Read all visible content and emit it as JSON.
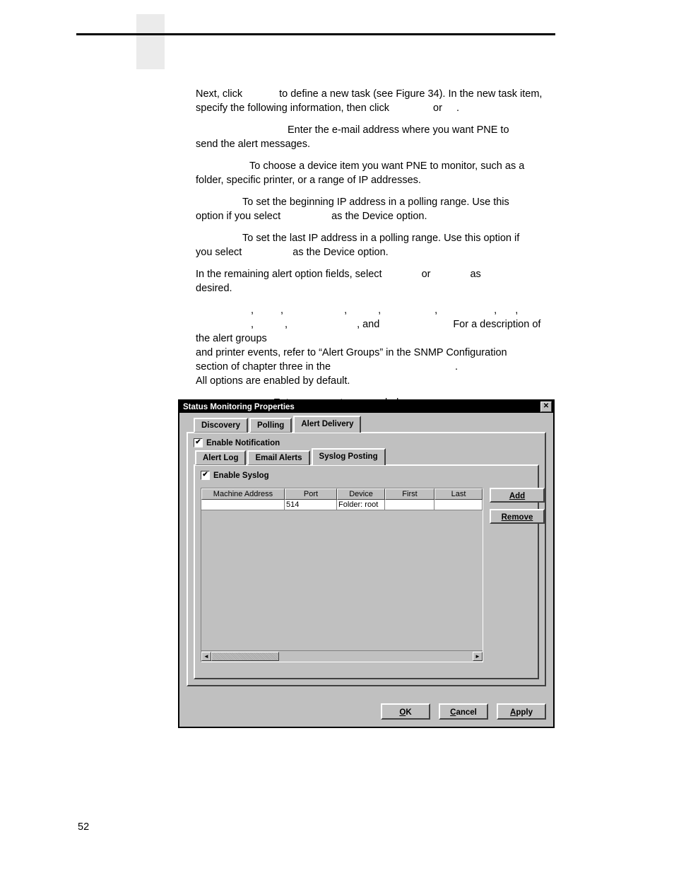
{
  "page": {
    "number": "52"
  },
  "body": {
    "p1_a": "Next, click",
    "p1_b": "to define a new task (see Figure 34). In the new task item,",
    "p1_c": "specify the following information, then click",
    "p1_d": "or",
    "p1_e": ".",
    "p2_a": "Enter the e-mail address where you want PNE to",
    "p2_b": "send the alert messages.",
    "p3_a": "To choose a device item you want PNE to monitor, such as a",
    "p3_b": "folder, specific printer, or a range of IP addresses.",
    "p4_a": "To set the beginning IP address in a polling range. Use this",
    "p4_b": "option if you select",
    "p4_c": "as the Device option.",
    "p5_a": "To set the last IP address in a polling range. Use this option if",
    "p5_b": "you select",
    "p5_c": "as the Device option.",
    "p6_a": "In the remaining alert option fields, select",
    "p6_b": "or",
    "p6_c": "as",
    "p6_d": "desired.",
    "p7_a": ",",
    "p7_b": ",",
    "p7_c": ",",
    "p7_d": ",",
    "p7_e": ",",
    "p7_f": ",",
    "p7_g": ",",
    "p7_h": ",",
    "p7_i": ",",
    "p7_j": ", and",
    "p7_k": "For a description of the alert groups",
    "p7_l": "and printer events, refer to “Alert Groups” in the SNMP Configuration",
    "p7_m": "section of chapter three in the",
    "p7_n": ".",
    "p7_o": "All options are enabled by default.",
    "p8_a": "Enter comments as needed."
  },
  "dialog": {
    "title": "Status Monitoring Properties",
    "close_label": "✕",
    "outer_tabs": [
      {
        "label": "Discovery",
        "selected": false
      },
      {
        "label": "Polling",
        "selected": false
      },
      {
        "label": "Alert Delivery",
        "selected": true
      }
    ],
    "enable_notification": {
      "label": "Enable Notification",
      "checked": true,
      "check_glyph": "✔"
    },
    "inner_tabs": [
      {
        "label": "Alert Log",
        "selected": false
      },
      {
        "label": "Email Alerts",
        "selected": false
      },
      {
        "label": "Syslog Posting",
        "selected": true
      }
    ],
    "enable_syslog": {
      "label": "Enable Syslog",
      "checked": true,
      "check_glyph": "✔"
    },
    "table": {
      "columns": [
        "Machine Address",
        "Port",
        "Device",
        "First",
        "Last"
      ],
      "rows": [
        {
          "machine_address": "",
          "port": "514",
          "device": "Folder: root",
          "first": "",
          "last": ""
        }
      ]
    },
    "side_buttons": [
      {
        "label": "Add"
      },
      {
        "label": "Remove"
      }
    ],
    "footer_buttons": [
      {
        "label": "OK",
        "mnemonic": "O",
        "rest": "K"
      },
      {
        "label": "Cancel",
        "mnemonic": "C",
        "rest": "ancel"
      },
      {
        "label": "Apply",
        "mnemonic": "A",
        "rest": "pply"
      }
    ],
    "scroll": {
      "left_arrow": "◄",
      "right_arrow": "►"
    }
  }
}
